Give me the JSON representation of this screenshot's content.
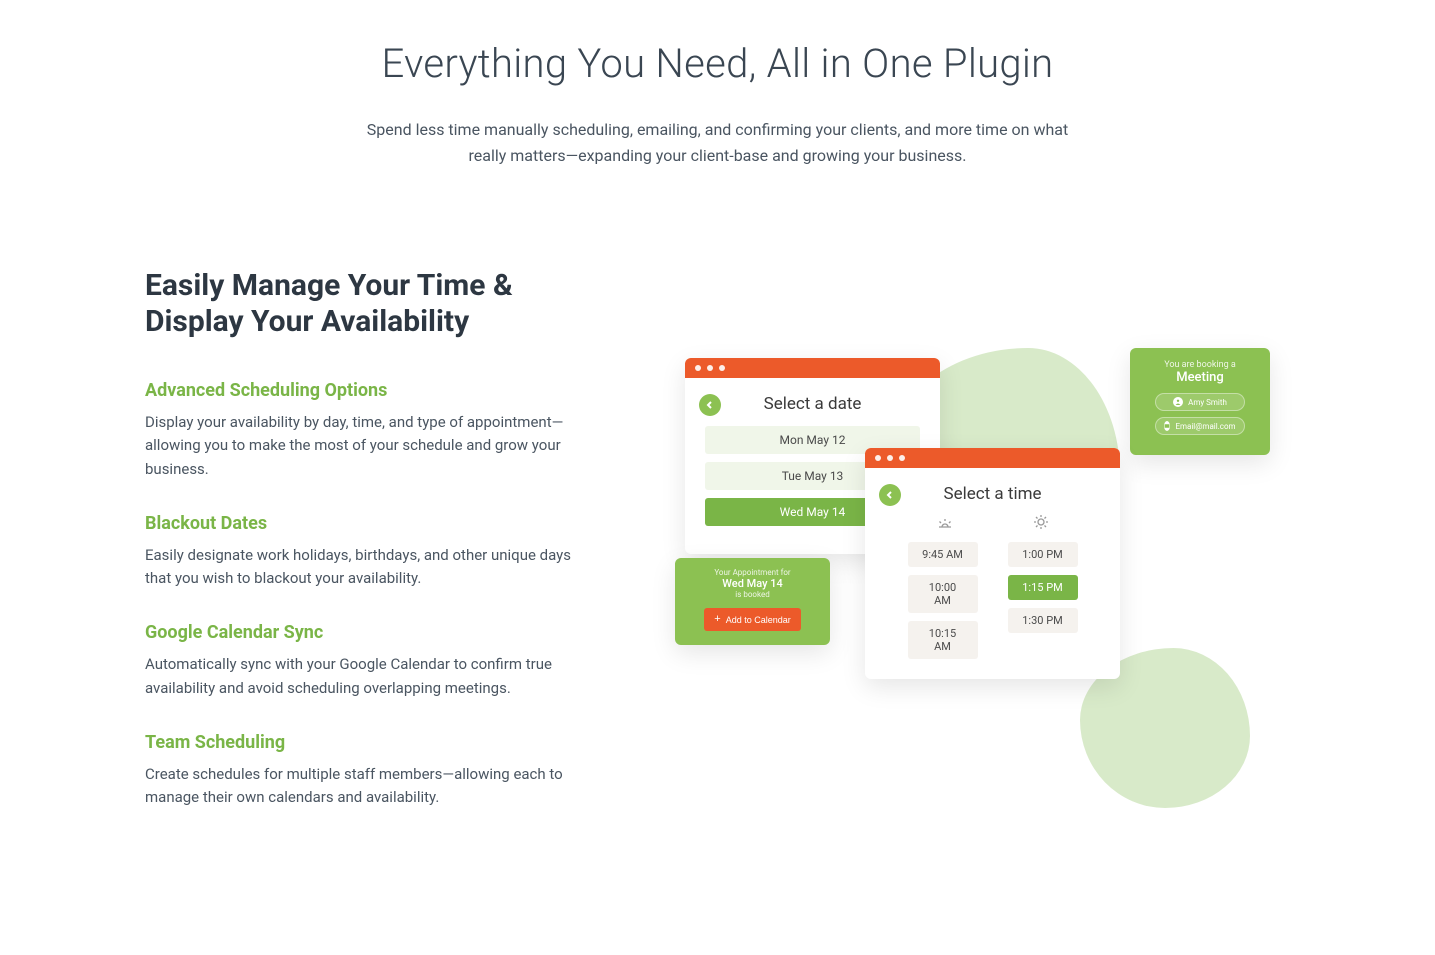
{
  "hero": {
    "title": "Everything You Need, All in One Plugin",
    "subtitle": "Spend less time manually scheduling, emailing, and confirming your clients, and more time on what really matters—expanding your client-base and growing your business."
  },
  "section": {
    "heading": "Easily Manage Your Time & Display Your Availability",
    "features": [
      {
        "title": "Advanced Scheduling Options",
        "body": "Display your availability by day, time, and type of appointment—allowing you to make the most of your schedule and grow your business."
      },
      {
        "title": "Blackout Dates",
        "body": "Easily designate work holidays, birthdays, and other unique days that you wish to blackout your availability."
      },
      {
        "title": "Google Calendar Sync",
        "body": "Automatically sync with your Google Calendar to confirm true availability and avoid scheduling overlapping meetings."
      },
      {
        "title": "Team Scheduling",
        "body": "Create schedules for multiple staff members—allowing each to manage their own calendars and availability."
      }
    ]
  },
  "mock": {
    "date_card": {
      "title": "Select a date",
      "dates": [
        "Mon May 12",
        "Tue May 13",
        "Wed May 14"
      ],
      "selected_index": 2
    },
    "time_card": {
      "title": "Select a time",
      "am": [
        "9:45 AM",
        "10:00 AM",
        "10:15 AM"
      ],
      "pm": [
        "1:00 PM",
        "1:15 PM",
        "1:30 PM"
      ],
      "selected_pm_index": 1
    },
    "booking_card": {
      "line1": "You are booking a",
      "line2": "Meeting",
      "name": "Amy Smith",
      "email": "Email@mail.com"
    },
    "confirm_card": {
      "l1": "Your Appointment for",
      "l2": "Wed May 14",
      "l3": "is booked",
      "button": "Add to Calendar"
    }
  }
}
